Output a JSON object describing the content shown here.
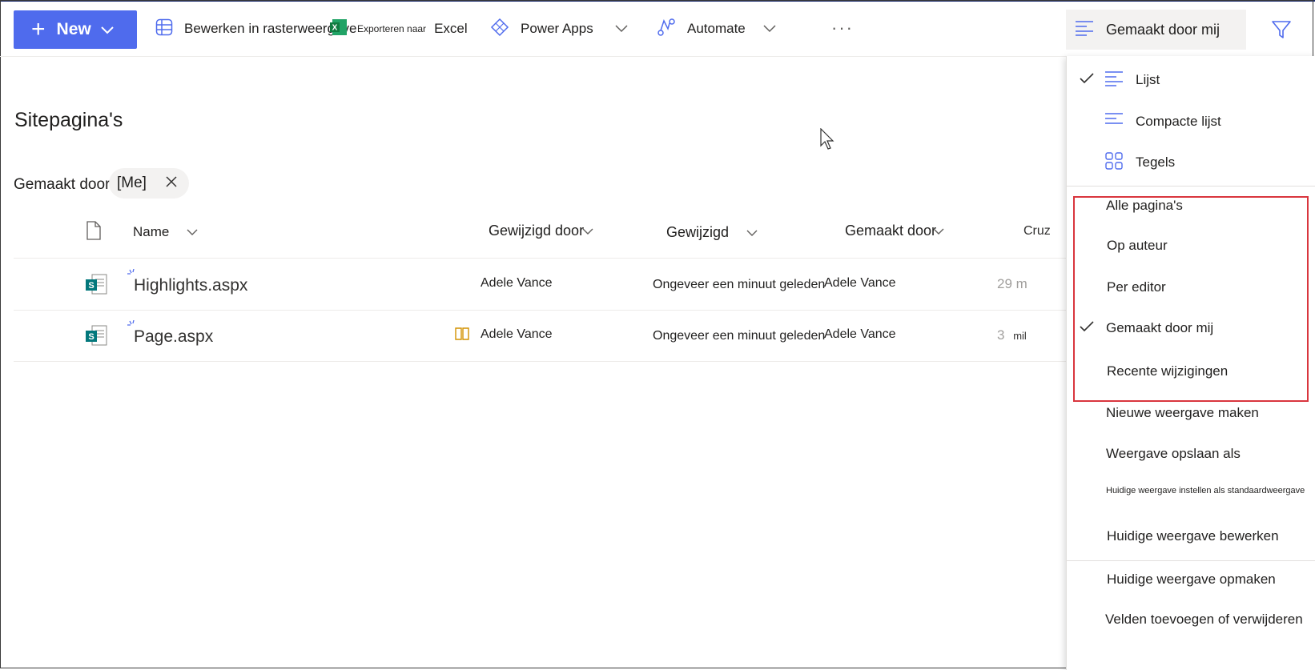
{
  "command_bar": {
    "new_label": "New",
    "grid_edit_label": "Bewerken in rasterweergave",
    "export_small_label": "Exporteren naar",
    "export_excel_label": "Excel",
    "power_apps_label": "Power Apps",
    "automate_label": "Automate",
    "more_label": "···",
    "view_switch_label": "Gemaakt door mij"
  },
  "content": {
    "page_title": "Sitepagina's",
    "filter_label": "Gemaakt door:",
    "filter_value": "[Me]",
    "columns": {
      "name": "Name",
      "modified_by": "Gewijzigd door",
      "modified": "Gewijzigd",
      "created_by": "Gemaakt door",
      "cruz": "Cruz"
    },
    "rows": [
      {
        "name": "Highlights.aspx",
        "modified_by": "Adele Vance",
        "modified": "Ongeveer een minuut geleden",
        "created_by": "Adele Vance",
        "cruz": "29 m"
      },
      {
        "name": "Page.aspx",
        "modified_by": "Adele Vance",
        "modified": "Ongeveer een minuut geleden",
        "created_by": "Adele Vance",
        "cruz": "3",
        "cruz_suffix": "mil"
      }
    ]
  },
  "view_menu": {
    "layouts": [
      {
        "label": "Lijst",
        "checked": true,
        "icon": "list-icon"
      },
      {
        "label": "Compacte lijst",
        "checked": false,
        "icon": "compact-list-icon"
      },
      {
        "label": "Tegels",
        "checked": false,
        "icon": "tiles-icon"
      }
    ],
    "views": [
      {
        "label": "Alle pagina's",
        "checked": false
      },
      {
        "label": "Op auteur",
        "checked": false
      },
      {
        "label": "Per editor",
        "checked": false
      },
      {
        "label": "Gemaakt door mij",
        "checked": true
      },
      {
        "label": "Recente wijzigingen",
        "checked": false
      }
    ],
    "actions": [
      "Nieuwe weergave maken",
      "Weergave opslaan als",
      "Huidige weergave instellen als standaardweergave",
      "Huidige weergave bewerken",
      "Huidige weergave opmaken",
      "Velden toevoegen of verwijderen"
    ]
  },
  "colors": {
    "accent": "#4f6bed",
    "highlight_border": "#d9363e",
    "sharepoint_green": "#03787c"
  }
}
